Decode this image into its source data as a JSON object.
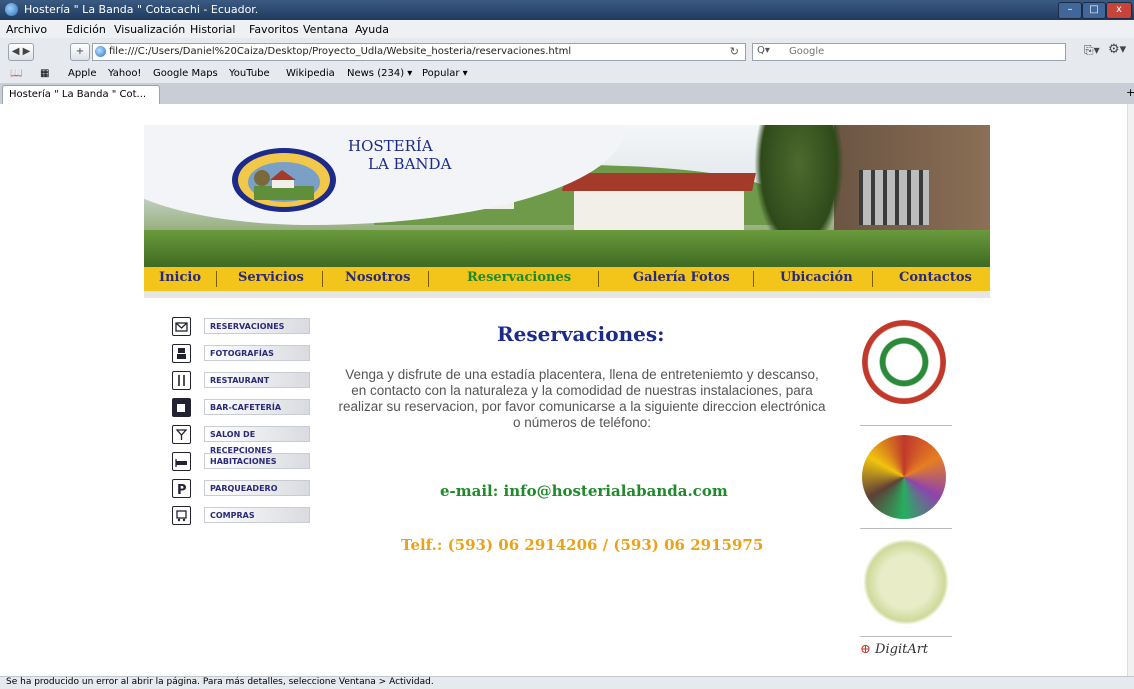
{
  "window": {
    "title": "Hostería \" La Banda \" Cotacachi - Ecuador."
  },
  "menubar": [
    "Archivo",
    "Edición",
    "Visualización",
    "Historial",
    "Favoritos",
    "Ventana",
    "Ayuda"
  ],
  "toolbar": {
    "address": "file:///C:/Users/Daniel%20Caiza/Desktop/Proyecto_Udla/Website_hosteria/reservaciones.html",
    "search_placeholder": "Google"
  },
  "bookmarks": [
    "Apple",
    "Yahoo!",
    "Google Maps",
    "YouTube",
    "Wikipedia",
    "News (234) ▾",
    "Popular ▾"
  ],
  "tab": {
    "label": "Hostería \" La Banda \" Cot..."
  },
  "site": {
    "name_line1": "HOSTERÍA",
    "name_line2": "LA BANDA",
    "nav": [
      "Inicio",
      "Servicios",
      "Nosotros",
      "Reservaciones",
      "Galería Fotos",
      "Ubicación",
      "Contactos"
    ],
    "active_nav": "Reservaciones"
  },
  "sidebar": [
    {
      "label": "RESERVACIONES",
      "icon": "envelope-icon"
    },
    {
      "label": "FOTOGRAFÍAS",
      "icon": "camera-icon"
    },
    {
      "label": "RESTAURANT",
      "icon": "fork-knife-icon"
    },
    {
      "label": "BAR-CAFETERÍA",
      "icon": "cup-icon"
    },
    {
      "label": "SALON DE RECEPCIONES",
      "icon": "glass-icon"
    },
    {
      "label": "HABITACIONES",
      "icon": "bed-icon"
    },
    {
      "label": "PARQUEADERO",
      "icon": "parking-icon"
    },
    {
      "label": "COMPRAS",
      "icon": "cart-icon"
    }
  ],
  "main": {
    "title": "Reservaciones:",
    "body": "Venga y disfrute de una estadía placentera, llena de entreteniemto y descanso, en contacto con la naturaleza y la comodidad de nuestras instalaciones, para realizar su reservacion, por favor comunicarse a la siguiente direccion electrónica o números de teléfono:",
    "email": "e-mail: info@hosterialabanda.com",
    "phone": "Telf.: (593) 06 2914206 / (593) 06 2915975"
  },
  "sponsors": {
    "digitart": "DigitArt"
  },
  "status": "Se ha producido un error al abrir la página. Para más detalles, seleccione Ventana > Actividad.",
  "colors": {
    "nav_strip": "#f3c41a",
    "nav_text": "#2a2a7a",
    "nav_active": "#1f8a2a",
    "email": "#1f8a2a",
    "phone": "#e9a31a",
    "title": "#1c2a8a"
  }
}
